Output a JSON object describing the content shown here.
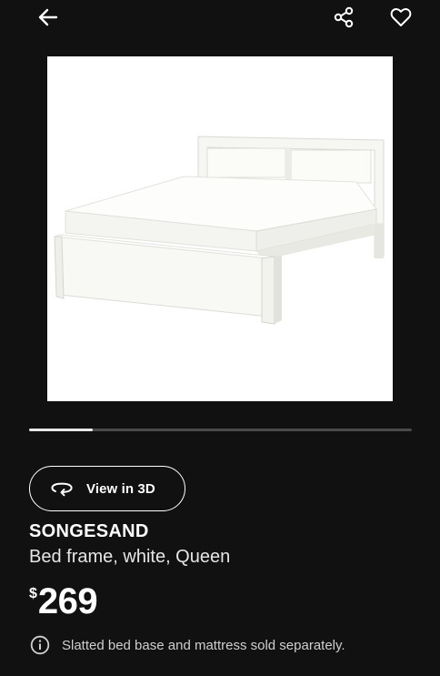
{
  "header": {
    "back_icon": "arrow-left-icon",
    "share_icon": "share-icon",
    "favorite_icon": "heart-outline-icon"
  },
  "gallery": {
    "progress": 0.167
  },
  "actions": {
    "view_3d_label": "View in 3D",
    "view_3d_icon": "rotate-3d-icon"
  },
  "product": {
    "name": "SONGESAND",
    "description": "Bed frame, white, Queen",
    "currency_symbol": "$",
    "price": "269",
    "info_icon": "info-circle-icon",
    "notice": "Slatted bed base and mattress sold separately."
  },
  "colors": {
    "background": "#111111",
    "text": "#ffffff",
    "track": "#4a4a4a",
    "track_fill": "#e8e8e8"
  }
}
